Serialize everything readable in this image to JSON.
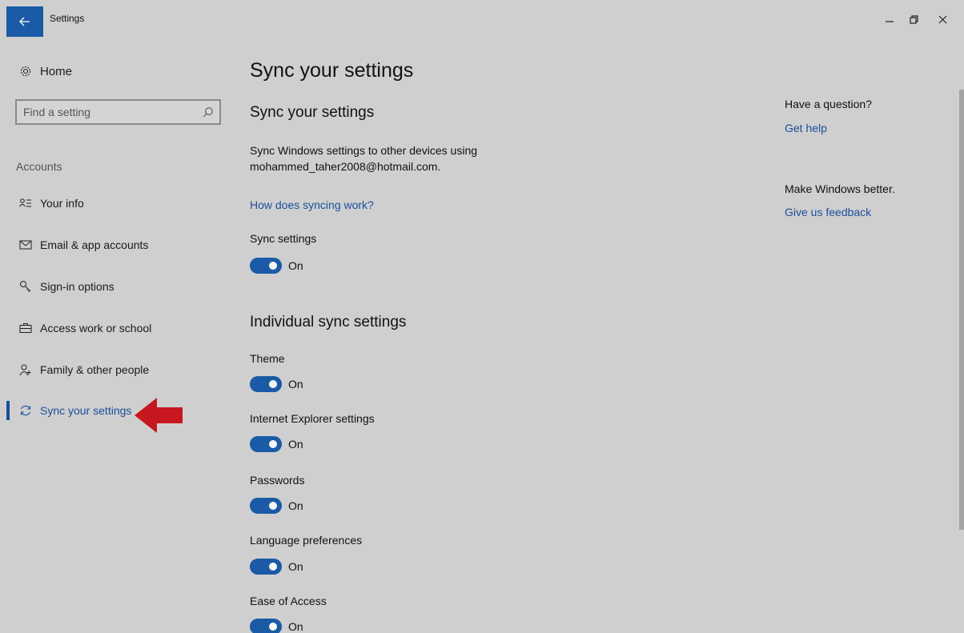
{
  "window": {
    "title": "Settings",
    "controls": {
      "minimize": "–",
      "restore": "❐",
      "close": "X"
    }
  },
  "nav": {
    "home_label": "Home",
    "search_placeholder": "Find a setting",
    "section_label": "Accounts",
    "items": [
      {
        "label": "Your info",
        "icon": "person-list-icon"
      },
      {
        "label": "Email & app accounts",
        "icon": "mail-icon"
      },
      {
        "label": "Sign-in options",
        "icon": "key-icon"
      },
      {
        "label": "Access work or school",
        "icon": "briefcase-icon"
      },
      {
        "label": "Family & other people",
        "icon": "person-add-icon"
      },
      {
        "label": "Sync your settings",
        "icon": "sync-icon",
        "active": true
      }
    ]
  },
  "main": {
    "page_title": "Sync your settings",
    "section_title": "Sync your settings",
    "description_line1": "Sync Windows settings to other devices using",
    "description_line2": "mohammed_taher2008@hotmail.com.",
    "how_link": "How does syncing work?",
    "sync_settings": {
      "label": "Sync settings",
      "state": "On",
      "on": true
    },
    "individual_title": "Individual sync settings",
    "individual": [
      {
        "label": "Theme",
        "state": "On",
        "on": true
      },
      {
        "label": "Internet Explorer settings",
        "state": "On",
        "on": true
      },
      {
        "label": "Passwords",
        "state": "On",
        "on": true
      },
      {
        "label": "Language preferences",
        "state": "On",
        "on": true
      },
      {
        "label": "Ease of Access",
        "state": "On",
        "on": true
      }
    ]
  },
  "aside": {
    "question": "Have a question?",
    "get_help": "Get help",
    "make_better": "Make Windows better.",
    "feedback": "Give us feedback"
  },
  "colors": {
    "accent": "#1a5aa6",
    "link": "#1a4f9c",
    "background": "#cfcfcf",
    "annotation_arrow": "#c8171e"
  }
}
